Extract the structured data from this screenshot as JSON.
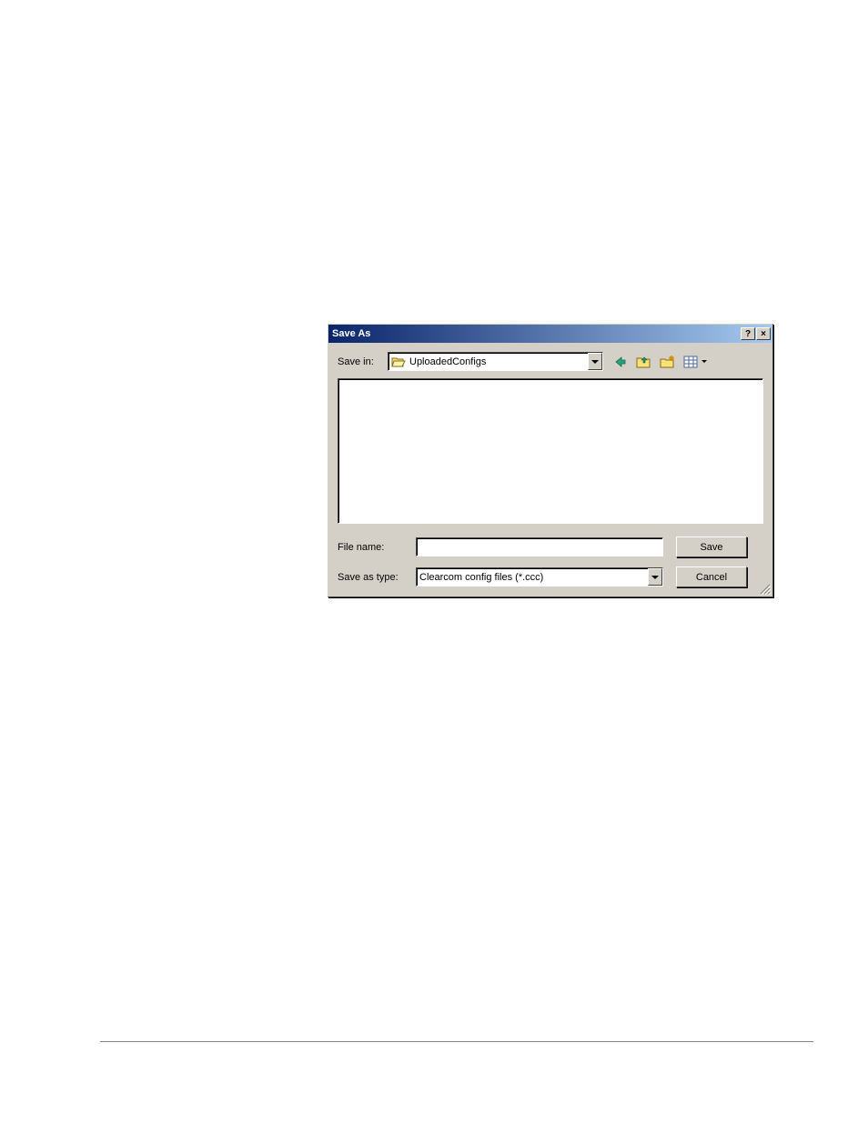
{
  "dialog": {
    "title": "Save As",
    "help_tip": "?",
    "close_tip": "×",
    "save_in_label": "Save in:",
    "save_in_value": "UploadedConfigs",
    "file_name_label": "File name:",
    "file_name_value": "",
    "save_as_type_label": "Save as type:",
    "save_as_type_value": "Clearcom config files (*.ccc)",
    "save_button": "Save",
    "cancel_button": "Cancel"
  }
}
